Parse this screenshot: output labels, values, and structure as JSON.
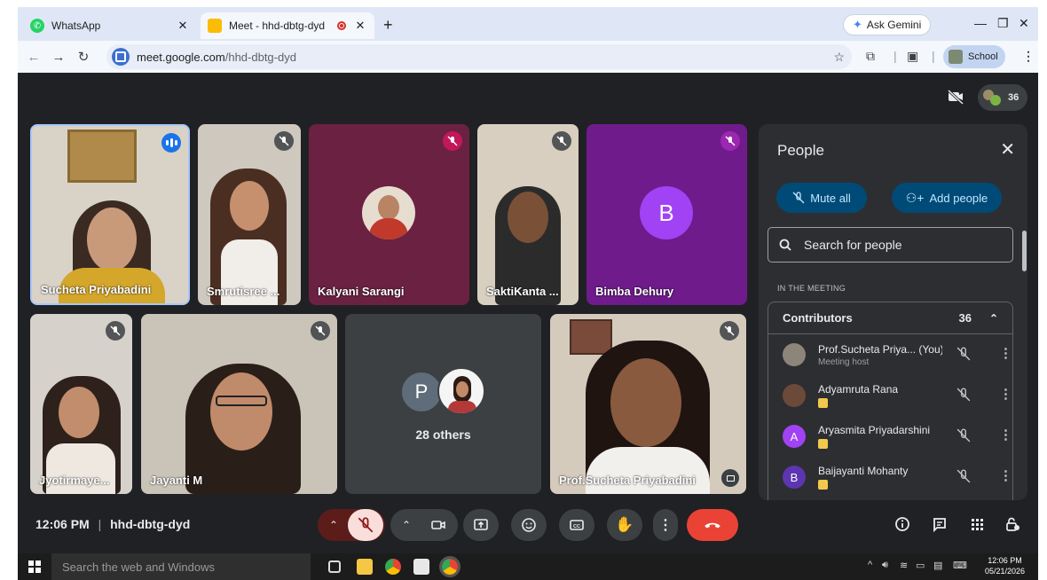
{
  "browser": {
    "tabs": [
      {
        "title": "WhatsApp",
        "active": false
      },
      {
        "title": "Meet - hhd-dbtg-dyd",
        "active": true
      }
    ],
    "gemini_label": "Ask Gemini",
    "url_domain": "meet.google.com",
    "url_path": "/hhd-dbtg-dyd",
    "profile_label": "School"
  },
  "meet": {
    "participant_count_badge": "36",
    "tiles": [
      {
        "name": "Sucheta Priyabadini"
      },
      {
        "name": "Smrutisree ..."
      },
      {
        "name": "Kalyani Sarangi"
      },
      {
        "name": "SaktiKanta ..."
      },
      {
        "name": "Bimba Dehury",
        "initial": "B"
      },
      {
        "name": "Jyotirmaye..."
      },
      {
        "name": "Jayanti M"
      },
      {
        "name": "28 others",
        "initial": "P"
      },
      {
        "name": "Prof.Sucheta Priyabadini"
      }
    ],
    "meeting_time": "12:06 PM",
    "meeting_code": "hhd-dbtg-dyd"
  },
  "people_panel": {
    "title": "People",
    "mute_all": "Mute all",
    "add_people": "Add people",
    "search_placeholder": "Search for people",
    "section_label": "IN THE MEETING",
    "group_label": "Contributors",
    "group_count": "36",
    "participants": [
      {
        "name": "Prof.Sucheta Priya... (You)",
        "sub": "Meeting host",
        "initial": ""
      },
      {
        "name": "Adyamruta Rana",
        "sub": "",
        "initial": ""
      },
      {
        "name": "Aryasmita Priyadarshini",
        "sub": "",
        "initial": "A"
      },
      {
        "name": "Baijayanti Mohanty",
        "sub": "",
        "initial": "B"
      }
    ]
  },
  "taskbar": {
    "search_placeholder": "Search the web and Windows",
    "time": "12:06 PM",
    "date": "05/21/2026"
  },
  "colors": {
    "meet_bg": "#202124",
    "end_call": "#ea4335",
    "mic_muted": "#f9dedc",
    "accent_pill": "#004a77"
  }
}
